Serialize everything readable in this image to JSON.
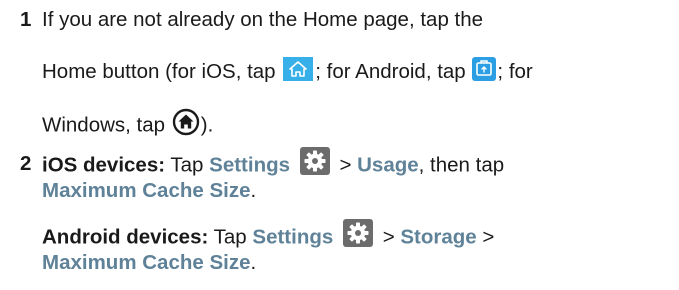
{
  "steps": [
    {
      "number": "1",
      "line1": "If you are not already on the Home page, tap the",
      "line2_a": "Home button (for iOS, tap",
      "line2_b": "; for Android, tap",
      "line2_c": "; for",
      "line3_a": "Windows, tap",
      "line3_b": ")."
    },
    {
      "number": "2",
      "ios_label": "iOS devices:",
      "ios_tap": "Tap",
      "ios_settings": "Settings",
      "ios_sep": ">",
      "ios_usage": "Usage",
      "ios_then": ", then tap",
      "ios_max_cache": "Maximum Cache Size",
      "ios_end": ".",
      "android_label": "Android devices:",
      "android_tap": "Tap",
      "android_settings": "Settings",
      "android_sep1": ">",
      "android_storage": "Storage",
      "android_sep2": ">",
      "android_max_cache": "Maximum Cache Size",
      "android_end": "."
    }
  ],
  "icons": {
    "ios_home": "ios-home-icon",
    "android_home": "android-home-icon",
    "windows_home": "windows-home-icon",
    "settings": "settings-gear-icon"
  },
  "colors": {
    "ui_text": "#5f8299",
    "ios_home_bg": "#37b0ea",
    "android_home_bg": "#2c9fe4",
    "gear_bg": "#6c6c6c"
  }
}
